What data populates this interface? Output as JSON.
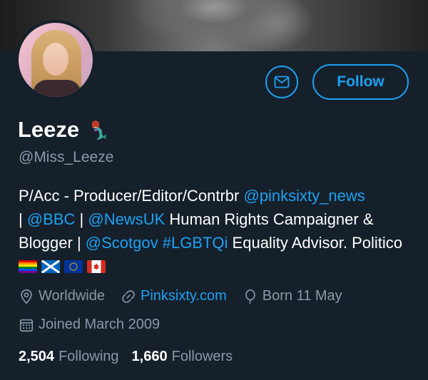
{
  "profile": {
    "display_name": "Leeze",
    "handle": "@Miss_Leeze",
    "follow_label": "Follow"
  },
  "bio": {
    "line1_text": "P/Acc - Producer/Editor/Contrbr ",
    "line1_link": "@pinksixty_news",
    "sep1": "| ",
    "link_bbc": "@BBC",
    "sep2": " | ",
    "link_newsuk": "@NewsUK",
    "text_campaigner": " Human Rights Campaigner & Blogger | ",
    "link_scotgov": "@Scotgov",
    "space": " ",
    "link_lgbtqi": "#LGBTQi",
    "text_equality": " Equality Advisor. Politico "
  },
  "meta": {
    "location": "Worldwide",
    "website": "Pinksixty.com",
    "birthday": "Born 11 May",
    "joined": "Joined March 2009"
  },
  "stats": {
    "following_count": "2,504",
    "following_label": "Following",
    "followers_count": "1,660",
    "followers_label": "Followers"
  },
  "icons": {
    "message": "envelope-icon",
    "location": "location-pin-icon",
    "website": "link-icon",
    "birthday": "balloon-icon",
    "joined": "calendar-icon",
    "name_emoji": "mermaid-icon",
    "flags": [
      "rainbow-flag-icon",
      "scotland-flag-icon",
      "eu-flag-icon",
      "canada-flag-icon"
    ]
  },
  "colors": {
    "background": "#15202b",
    "accent": "#1da1f2",
    "secondary_text": "#8899a6"
  }
}
